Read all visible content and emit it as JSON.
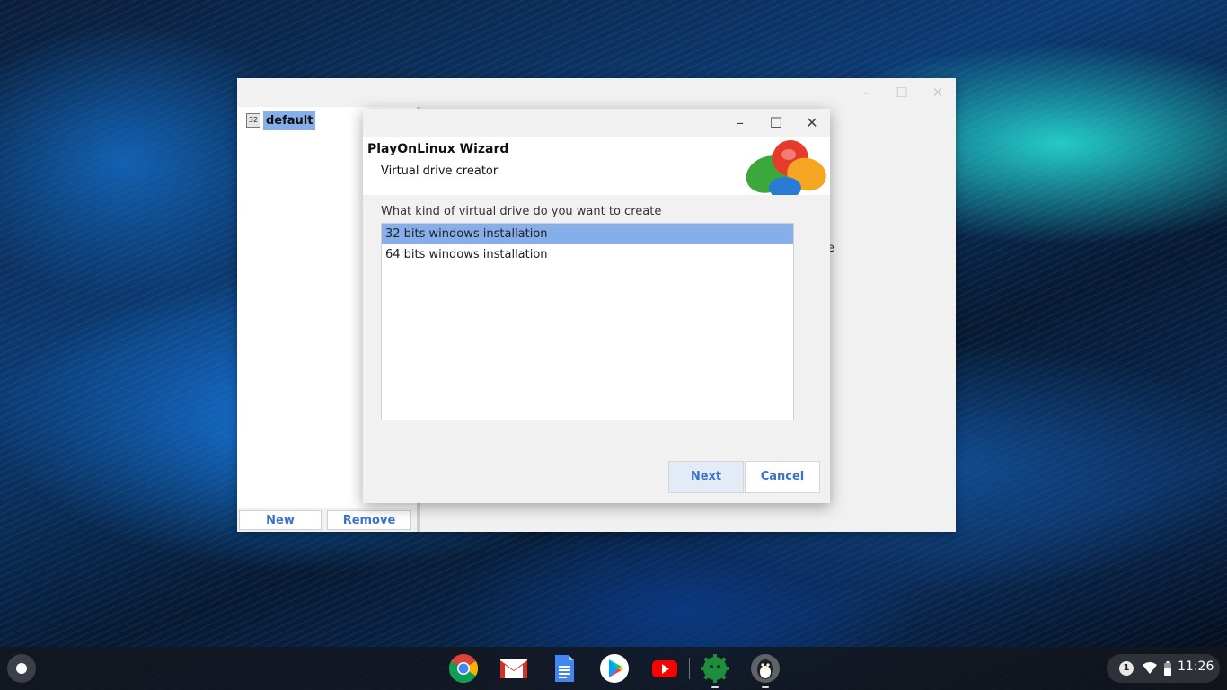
{
  "manager_window": {
    "prefix_list": [
      {
        "icon_text": "32",
        "label": "default"
      }
    ],
    "buttons": {
      "new": "New",
      "remove": "Remove"
    },
    "partial_text": "e"
  },
  "wizard": {
    "title": "PlayOnLinux Wizard",
    "subtitle": "Virtual drive creator",
    "question": "What kind of virtual drive do you want to create",
    "options": [
      {
        "label": "32 bits windows installation",
        "selected": true
      },
      {
        "label": "64 bits windows installation",
        "selected": false
      }
    ],
    "buttons": {
      "next": "Next",
      "cancel": "Cancel"
    },
    "controls": {
      "minimize": "–",
      "maximize": "☐",
      "close": "✕"
    }
  },
  "shelf": {
    "apps": [
      "chrome-icon",
      "gmail-icon",
      "docs-icon",
      "play-store-icon",
      "youtube-icon",
      "settings-gear-icon",
      "penguin-icon"
    ],
    "tray": {
      "notification_count": "1",
      "time": "11:26"
    }
  },
  "colors": {
    "selection": "#86aeea",
    "button_text": "#3a73c8"
  }
}
